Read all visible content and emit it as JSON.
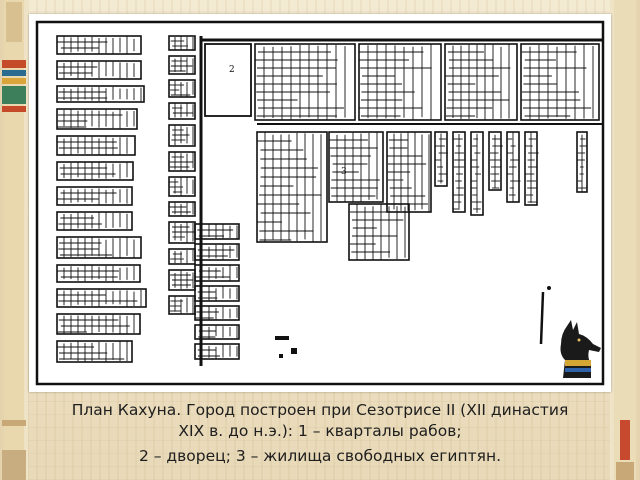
{
  "slide": {
    "caption": {
      "line1": "План Кахуна. Город построен при Сезотрисе II (XII династия",
      "line2": "XIX в. до н.э.): 1 – кварталы рабов;",
      "line3": "2 – дворец; 3 – жилища свободных египтян."
    },
    "plan": {
      "label_2": "2",
      "label_3": "3"
    },
    "decorations": [
      "egyptian-pillar-icon",
      "anubis-jackal-icon"
    ],
    "colors": {
      "background": "#efe4c8",
      "plan_ink": "#111111",
      "plan_paper": "#ffffff"
    }
  }
}
